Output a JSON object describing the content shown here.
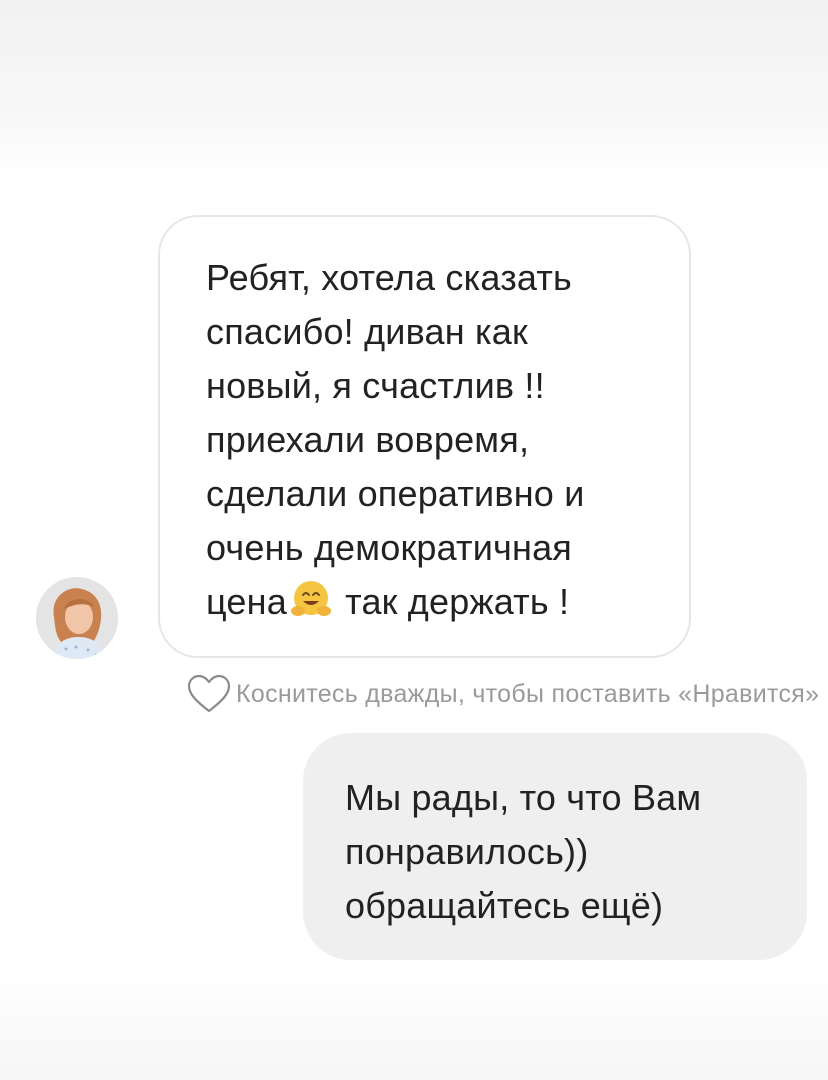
{
  "conversation": {
    "incoming": {
      "text_before_emoji": "Ребят, хотела сказать\nспасибо! диван как\nновый, я счастлив !!\nприехали вовремя,\nсделали оперативно и\nочень демократичная\nцена",
      "emoji": "hugging-face-emoji",
      "text_after_emoji": " так держать !"
    },
    "like_hint": "Коснитесь дважды, чтобы поставить «Нравится»",
    "outgoing": {
      "text": "Мы рады, то что Вам\nпонравилось))\nобращайтесь ещё)"
    }
  },
  "colors": {
    "background": "#ffffff",
    "incoming_border": "#e6e6e6",
    "outgoing_bubble": "#efefef",
    "text": "#222222",
    "hint_text": "#9a9a9a",
    "emoji": "#f5c542"
  }
}
